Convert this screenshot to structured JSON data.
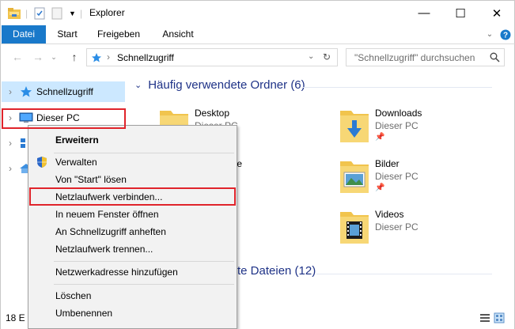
{
  "window": {
    "title": "Explorer",
    "controls": {
      "minimize": "—",
      "maximize": "☐",
      "close": "✕"
    }
  },
  "ribbon": {
    "tabs": [
      "Datei",
      "Start",
      "Freigeben",
      "Ansicht"
    ]
  },
  "address": {
    "path": "Schnellzugriff",
    "search_placeholder": "\"Schnellzugriff\" durchsuchen"
  },
  "nav": {
    "items": [
      {
        "label": "Schnellzugriff",
        "icon": "star-icon"
      },
      {
        "label": "Dieser PC",
        "icon": "computer-icon"
      },
      {
        "label": "",
        "icon": "network-icon"
      },
      {
        "label": "",
        "icon": "homegroup-icon"
      }
    ]
  },
  "content": {
    "frequent_header": "Häufig verwendete Ordner (6)",
    "recent_header_visible": "te Dateien (12)",
    "folders": [
      {
        "name": "Desktop",
        "location": "Dieser PC",
        "icon": "desktop-folder-icon"
      },
      {
        "name": "Downloads",
        "location": "Dieser PC",
        "icon": "downloads-folder-icon"
      },
      {
        "name": "te",
        "location": "",
        "icon": "documents-folder-icon"
      },
      {
        "name": "Bilder",
        "location": "Dieser PC",
        "icon": "pictures-folder-icon"
      },
      {
        "name": "Videos",
        "location": "Dieser PC",
        "icon": "videos-folder-icon"
      }
    ]
  },
  "context_menu": {
    "items": [
      {
        "label": "Erweitern",
        "bold": true
      },
      {
        "label": "Verwalten",
        "icon": "uac-shield-icon"
      },
      {
        "label": "Von \"Start\" lösen"
      },
      {
        "label": "Netzlaufwerk verbinden..."
      },
      {
        "label": "In neuem Fenster öffnen"
      },
      {
        "label": "An Schnellzugriff anheften"
      },
      {
        "label": "Netzlaufwerk trennen..."
      },
      {
        "label": "Netzwerkadresse hinzufügen"
      },
      {
        "label": "Löschen"
      },
      {
        "label": "Umbenennen"
      }
    ]
  },
  "status": {
    "count_partial": "18 E"
  },
  "colors": {
    "accent": "#1979ca",
    "selection": "#cce8ff",
    "highlight": "#e0242b",
    "group_header": "#1e3287"
  }
}
